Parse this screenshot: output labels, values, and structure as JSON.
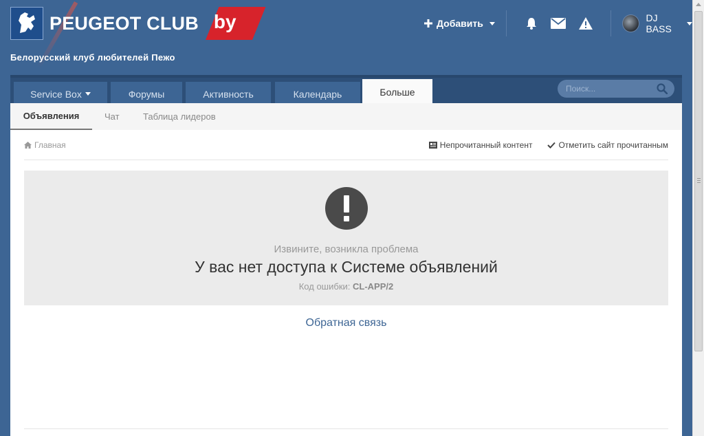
{
  "brand": {
    "name": "PEUGEOT CLUB",
    "suffix": "by",
    "tagline": "Белорусский клуб любителей Пежо"
  },
  "user_nav": {
    "add_label": "Добавить",
    "icons": [
      "bell-icon",
      "envelope-icon",
      "warning-icon"
    ],
    "username": "DJ BASS"
  },
  "nav": {
    "tabs": [
      {
        "label": "Service Box",
        "has_dropdown": true
      },
      {
        "label": "Форумы"
      },
      {
        "label": "Активность"
      },
      {
        "label": "Календарь"
      },
      {
        "label": "Больше",
        "active": true
      }
    ],
    "search_placeholder": "Поиск..."
  },
  "subnav": {
    "items": [
      {
        "label": "Объявления",
        "active": true
      },
      {
        "label": "Чат"
      },
      {
        "label": "Таблица лидеров"
      }
    ]
  },
  "breadcrumb": {
    "home": "Главная",
    "unread": "Непрочитанный контент",
    "mark_read": "Отметить сайт прочитанным"
  },
  "error": {
    "subtitle": "Извините, возникла проблема",
    "title": "У вас нет доступа к Системе объявлений",
    "code_label": "Код ошибки:",
    "code": "CL-APP/2",
    "feedback": "Обратная связь"
  },
  "colors": {
    "header_bg": "#3d6594",
    "nav_bg": "#2d4f78",
    "brand_red": "#d7232b",
    "link": "#3d6594"
  }
}
